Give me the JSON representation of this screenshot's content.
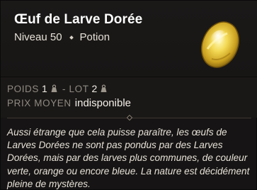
{
  "item": {
    "name": "Œuf de Larve Dorée",
    "level": "Niveau 50",
    "type": "Potion",
    "image": "golden-egg-icon"
  },
  "stats": {
    "weight_label": "POIDS",
    "weight_value": "1",
    "separator": "-",
    "lot_label": "LOT",
    "lot_value": "2",
    "price_label": "PRIX MOYEN",
    "price_value": "indisponible"
  },
  "description": "Aussi étrange que cela puisse paraître, les œufs de Larves Dorées ne sont pas pondus par des Larves Dorées, mais par des larves plus communes, de couleur verte, orange ou encore bleue. La nature est décidément pleine de mystères.",
  "colors": {
    "background": "#161414",
    "stats_background": "#1a1817",
    "label_grey": "#8f8a81",
    "egg_gold": "#e9c53a"
  }
}
